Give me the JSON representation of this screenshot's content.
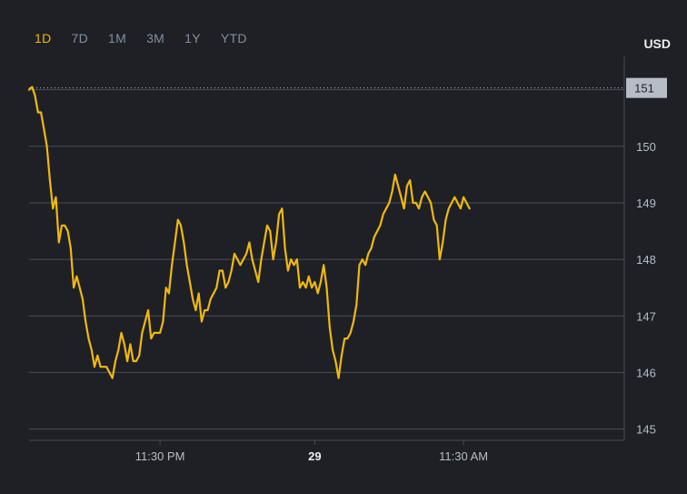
{
  "timeframe_tabs": [
    {
      "label": "1D",
      "active": true
    },
    {
      "label": "7D",
      "active": false
    },
    {
      "label": "1M",
      "active": false
    },
    {
      "label": "3M",
      "active": false
    },
    {
      "label": "1Y",
      "active": false
    },
    {
      "label": "YTD",
      "active": false
    }
  ],
  "currency_label": "USD",
  "colors": {
    "background": "#1e2026",
    "line": "#f0b90b",
    "grid": "#474d57",
    "axis_text": "#b7bdc6",
    "active_tab": "#f0b90b",
    "inactive_tab": "#848e9c",
    "price_tag_bg": "#b7bdc6"
  },
  "chart_data": {
    "type": "line",
    "current_price_label": "151",
    "current_price": 151.0,
    "ylim": [
      144.8,
      151.3
    ],
    "y_ticks": [
      145,
      146,
      147,
      148,
      149,
      150,
      151
    ],
    "x_ticks": [
      {
        "label": "11:30 PM",
        "at": 0.22,
        "bold": false
      },
      {
        "label": "29",
        "at": 0.48,
        "bold": true
      },
      {
        "label": "11:30 AM",
        "at": 0.73,
        "bold": false
      }
    ],
    "grid": true,
    "series": [
      {
        "values": [
          [
            0.0,
            151.0
          ],
          [
            0.005,
            151.05
          ],
          [
            0.01,
            150.9
          ],
          [
            0.015,
            150.6
          ],
          [
            0.02,
            150.6
          ],
          [
            0.025,
            150.3
          ],
          [
            0.03,
            150.0
          ],
          [
            0.035,
            149.4
          ],
          [
            0.04,
            148.9
          ],
          [
            0.045,
            149.1
          ],
          [
            0.05,
            148.3
          ],
          [
            0.055,
            148.6
          ],
          [
            0.06,
            148.6
          ],
          [
            0.065,
            148.5
          ],
          [
            0.07,
            148.2
          ],
          [
            0.075,
            147.5
          ],
          [
            0.08,
            147.7
          ],
          [
            0.085,
            147.5
          ],
          [
            0.09,
            147.3
          ],
          [
            0.095,
            146.9
          ],
          [
            0.1,
            146.6
          ],
          [
            0.105,
            146.4
          ],
          [
            0.11,
            146.1
          ],
          [
            0.115,
            146.3
          ],
          [
            0.12,
            146.1
          ],
          [
            0.125,
            146.1
          ],
          [
            0.13,
            146.1
          ],
          [
            0.135,
            146.0
          ],
          [
            0.14,
            145.9
          ],
          [
            0.145,
            146.2
          ],
          [
            0.15,
            146.4
          ],
          [
            0.155,
            146.7
          ],
          [
            0.16,
            146.5
          ],
          [
            0.165,
            146.2
          ],
          [
            0.17,
            146.5
          ],
          [
            0.175,
            146.2
          ],
          [
            0.18,
            146.2
          ],
          [
            0.185,
            146.3
          ],
          [
            0.19,
            146.7
          ],
          [
            0.195,
            146.9
          ],
          [
            0.2,
            147.1
          ],
          [
            0.205,
            146.6
          ],
          [
            0.21,
            146.7
          ],
          [
            0.215,
            146.7
          ],
          [
            0.22,
            146.7
          ],
          [
            0.225,
            146.9
          ],
          [
            0.23,
            147.5
          ],
          [
            0.235,
            147.4
          ],
          [
            0.24,
            147.9
          ],
          [
            0.245,
            148.3
          ],
          [
            0.25,
            148.7
          ],
          [
            0.255,
            148.6
          ],
          [
            0.26,
            148.3
          ],
          [
            0.265,
            147.9
          ],
          [
            0.27,
            147.6
          ],
          [
            0.275,
            147.3
          ],
          [
            0.28,
            147.1
          ],
          [
            0.285,
            147.4
          ],
          [
            0.29,
            146.9
          ],
          [
            0.295,
            147.1
          ],
          [
            0.3,
            147.1
          ],
          [
            0.305,
            147.3
          ],
          [
            0.31,
            147.4
          ],
          [
            0.315,
            147.5
          ],
          [
            0.32,
            147.8
          ],
          [
            0.325,
            147.8
          ],
          [
            0.33,
            147.5
          ],
          [
            0.335,
            147.6
          ],
          [
            0.34,
            147.8
          ],
          [
            0.345,
            148.1
          ],
          [
            0.35,
            148.0
          ],
          [
            0.355,
            147.9
          ],
          [
            0.36,
            148.0
          ],
          [
            0.365,
            148.1
          ],
          [
            0.37,
            148.3
          ],
          [
            0.375,
            148.0
          ],
          [
            0.38,
            147.8
          ],
          [
            0.385,
            147.6
          ],
          [
            0.39,
            148.0
          ],
          [
            0.395,
            148.3
          ],
          [
            0.4,
            148.6
          ],
          [
            0.405,
            148.5
          ],
          [
            0.41,
            148.0
          ],
          [
            0.415,
            148.3
          ],
          [
            0.42,
            148.8
          ],
          [
            0.425,
            148.9
          ],
          [
            0.43,
            148.2
          ],
          [
            0.435,
            147.8
          ],
          [
            0.44,
            148.0
          ],
          [
            0.445,
            147.9
          ],
          [
            0.45,
            148.0
          ],
          [
            0.455,
            147.5
          ],
          [
            0.46,
            147.6
          ],
          [
            0.465,
            147.5
          ],
          [
            0.47,
            147.7
          ],
          [
            0.475,
            147.5
          ],
          [
            0.48,
            147.6
          ],
          [
            0.485,
            147.4
          ],
          [
            0.49,
            147.6
          ],
          [
            0.495,
            147.9
          ],
          [
            0.5,
            147.5
          ],
          [
            0.505,
            146.8
          ],
          [
            0.51,
            146.4
          ],
          [
            0.515,
            146.2
          ],
          [
            0.52,
            145.9
          ],
          [
            0.525,
            146.3
          ],
          [
            0.53,
            146.6
          ],
          [
            0.535,
            146.6
          ],
          [
            0.54,
            146.7
          ],
          [
            0.545,
            146.9
          ],
          [
            0.55,
            147.2
          ],
          [
            0.555,
            147.9
          ],
          [
            0.56,
            148.0
          ],
          [
            0.565,
            147.9
          ],
          [
            0.57,
            148.1
          ],
          [
            0.575,
            148.2
          ],
          [
            0.58,
            148.4
          ],
          [
            0.585,
            148.5
          ],
          [
            0.59,
            148.6
          ],
          [
            0.595,
            148.8
          ],
          [
            0.6,
            148.9
          ],
          [
            0.605,
            149.0
          ],
          [
            0.61,
            149.2
          ],
          [
            0.615,
            149.5
          ],
          [
            0.62,
            149.3
          ],
          [
            0.625,
            149.1
          ],
          [
            0.63,
            148.9
          ],
          [
            0.635,
            149.3
          ],
          [
            0.64,
            149.4
          ],
          [
            0.645,
            149.0
          ],
          [
            0.65,
            149.0
          ],
          [
            0.655,
            148.9
          ],
          [
            0.66,
            149.1
          ],
          [
            0.665,
            149.2
          ],
          [
            0.67,
            149.1
          ],
          [
            0.675,
            149.0
          ],
          [
            0.68,
            148.7
          ],
          [
            0.685,
            148.6
          ],
          [
            0.69,
            148.0
          ],
          [
            0.695,
            148.3
          ],
          [
            0.7,
            148.7
          ],
          [
            0.705,
            148.9
          ],
          [
            0.71,
            149.0
          ],
          [
            0.715,
            149.1
          ],
          [
            0.72,
            149.0
          ],
          [
            0.725,
            148.9
          ],
          [
            0.73,
            149.1
          ],
          [
            0.735,
            149.0
          ],
          [
            0.74,
            148.9
          ]
        ]
      }
    ]
  }
}
